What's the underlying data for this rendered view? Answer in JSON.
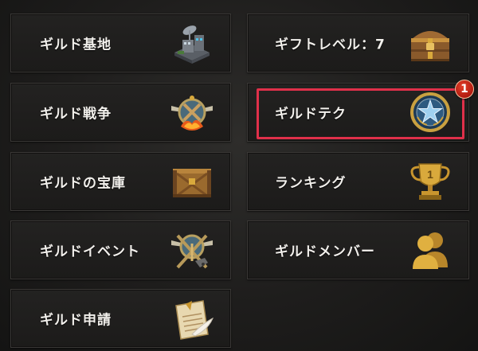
{
  "menu": {
    "guild_base": {
      "label": "ギルド基地",
      "icon": "base-building-icon"
    },
    "gift_level": {
      "label": "ギフトレベル：7",
      "icon": "treasure-chest-icon"
    },
    "guild_war": {
      "label": "ギルド戦争",
      "icon": "war-emblem-icon"
    },
    "guild_tech": {
      "label": "ギルドテク",
      "icon": "star-medal-icon"
    },
    "guild_treasury": {
      "label": "ギルドの宝庫",
      "icon": "wooden-crate-icon"
    },
    "ranking": {
      "label": "ランキング",
      "icon": "trophy-icon"
    },
    "guild_event": {
      "label": "ギルドイベント",
      "icon": "crossed-weapons-icon"
    },
    "guild_members": {
      "label": "ギルドメンバー",
      "icon": "members-icon"
    },
    "guild_application": {
      "label": "ギルド申請",
      "icon": "scroll-quill-icon"
    }
  },
  "notification": {
    "guild_tech_count": "1"
  },
  "colors": {
    "highlight_border": "#e0304a",
    "badge_red": "#c0201a",
    "label_text": "#f2f0ec",
    "gold": "#d9a93c"
  }
}
